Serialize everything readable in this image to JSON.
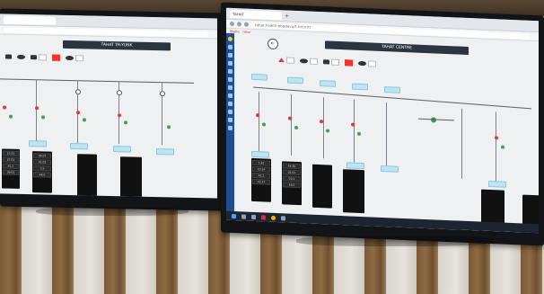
{
  "left_screen": {
    "browser_tab": "",
    "app_title": "TAHAT TR-YUNK",
    "panel_values": [
      "27.01",
      "27.01",
      "41.1",
      "39.01",
      "54.07",
      "01.01",
      "3.5",
      "49.5"
    ]
  },
  "right_screen": {
    "browser_tab": "TAHAT",
    "url": "tahat.health.etiadavurt.tr/ctr/tr",
    "bookmarks": [
      "Maple",
      "rekor"
    ],
    "app_title": "TAHAT CENTRE",
    "back_symbol": "←",
    "panel_values": [
      "5.45",
      "13.24",
      "41.1",
      "43.37",
      "54.30",
      "01.01",
      "20.1",
      "49.5"
    ]
  },
  "colors": {
    "alarm": "#e53935",
    "ok": "#43a047",
    "title_bar": "#2c3440",
    "taskbar": "#1e2530",
    "sidebar": "#1f4f8f"
  }
}
